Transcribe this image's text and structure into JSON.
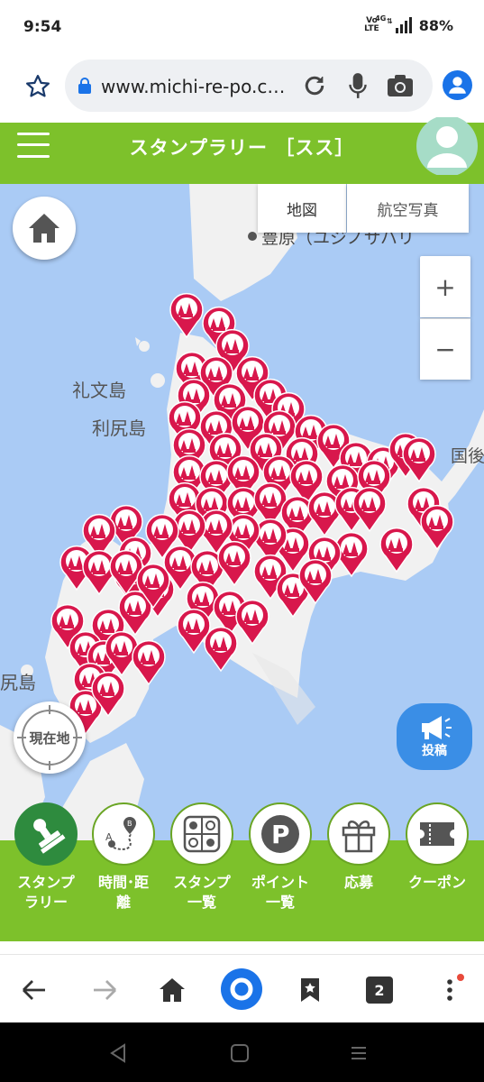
{
  "status_bar": {
    "time": "9:54",
    "volte": [
      "Vo",
      "LTE"
    ],
    "network": "4G",
    "battery": "88%"
  },
  "browser": {
    "url": "www.michi-re-po.c…",
    "tab_count": "2"
  },
  "header": {
    "title": "スタンプラリー ［スス］"
  },
  "map": {
    "tabs": [
      "地図",
      "航空写真"
    ],
    "zoom_in": "+",
    "zoom_out": "−",
    "labels": {
      "bg_place": "豊原（ユジノサハリ",
      "rebun": "礼文島",
      "rishiri": "利尻島",
      "kunashiri": "国後",
      "okushiri": "尻島"
    },
    "current_location": "現在地",
    "post_button": "投稿",
    "marker_color": "#d8174c"
  },
  "bottom_nav": [
    {
      "label": "スタンプ\nラリー",
      "icon": "stamp-icon"
    },
    {
      "label": "時間･距\n離",
      "icon": "route-icon"
    },
    {
      "label": "スタンプ\n一覧",
      "icon": "grid-list-icon"
    },
    {
      "label": "ポイント\n一覧",
      "icon": "parking-point-icon"
    },
    {
      "label": "応募",
      "icon": "gift-icon"
    },
    {
      "label": "クーポン",
      "icon": "ticket-icon"
    }
  ]
}
